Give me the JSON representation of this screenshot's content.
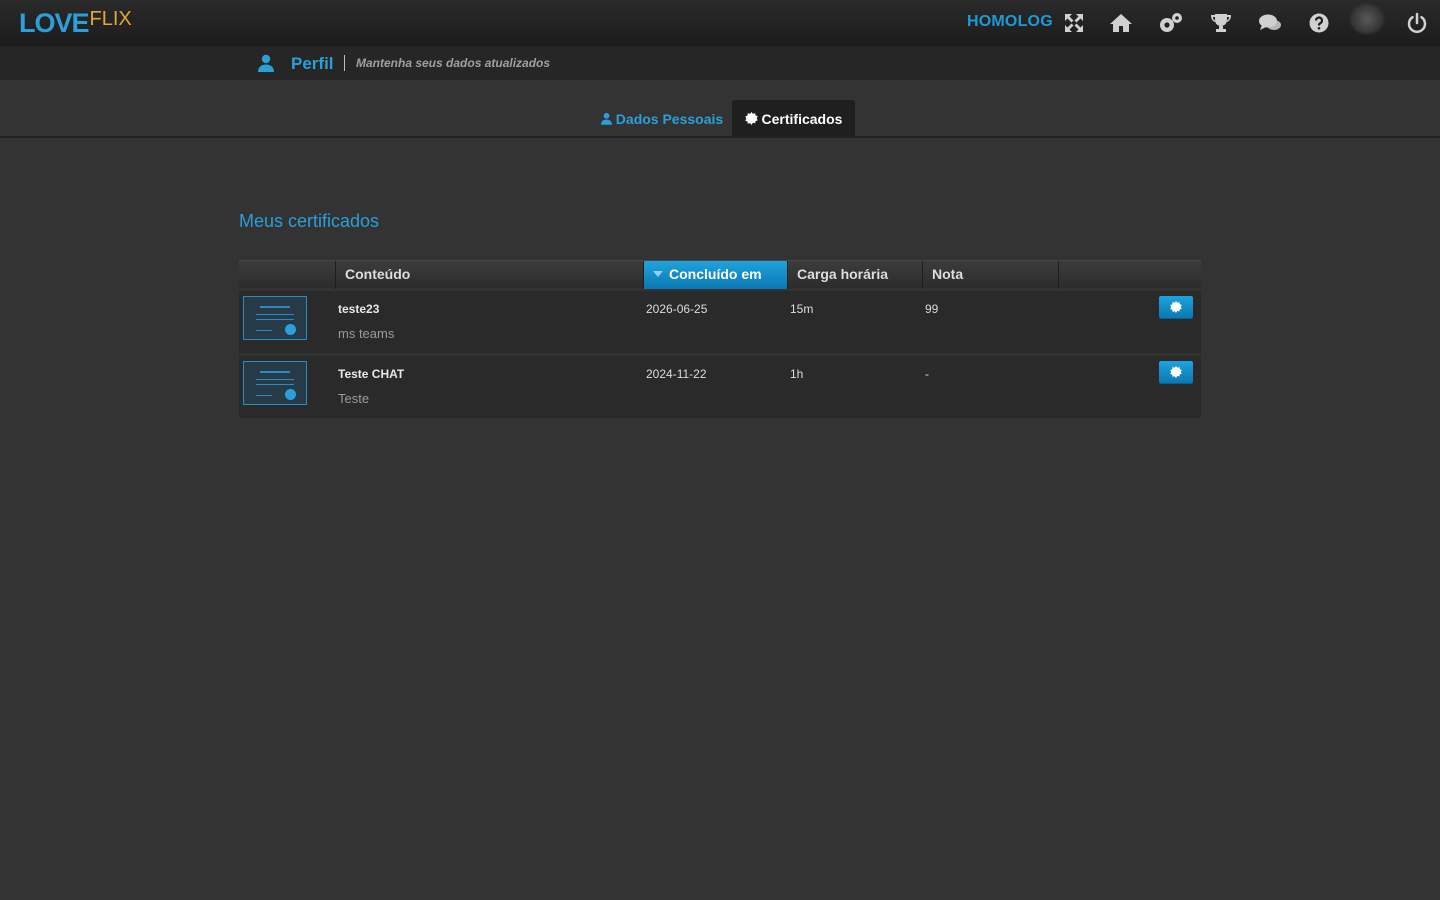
{
  "header": {
    "logo_primary": "LOVE",
    "logo_secondary": "FLIX",
    "environment": "HOMOLOG",
    "icons": [
      "fullscreen-icon",
      "home-icon",
      "settings-icon",
      "trophy-icon",
      "chat-icon",
      "help-icon",
      "power-icon"
    ]
  },
  "breadcrumb": {
    "title": "Perfil",
    "subtitle": "Mantenha seus dados atualizados"
  },
  "tabs": [
    {
      "label": "Dados Pessoais",
      "active": false
    },
    {
      "label": "Certificados",
      "active": true
    }
  ],
  "main": {
    "section_title": "Meus certificados",
    "table": {
      "columns": [
        "",
        "Conteúdo",
        "Concluído em",
        "Carga horária",
        "Nota",
        ""
      ],
      "sorted_column": "Concluído em",
      "rows": [
        {
          "title": "teste23",
          "subtitle": "ms teams",
          "completed": "2026-06-25",
          "hours": "15m",
          "grade": "99"
        },
        {
          "title": "Teste CHAT",
          "subtitle": "Teste",
          "completed": "2024-11-22",
          "hours": "1h",
          "grade": "-"
        }
      ]
    }
  },
  "colors": {
    "accent": "#2a9fd8",
    "logo_secondary": "#e2a72e",
    "background": "#333333"
  }
}
